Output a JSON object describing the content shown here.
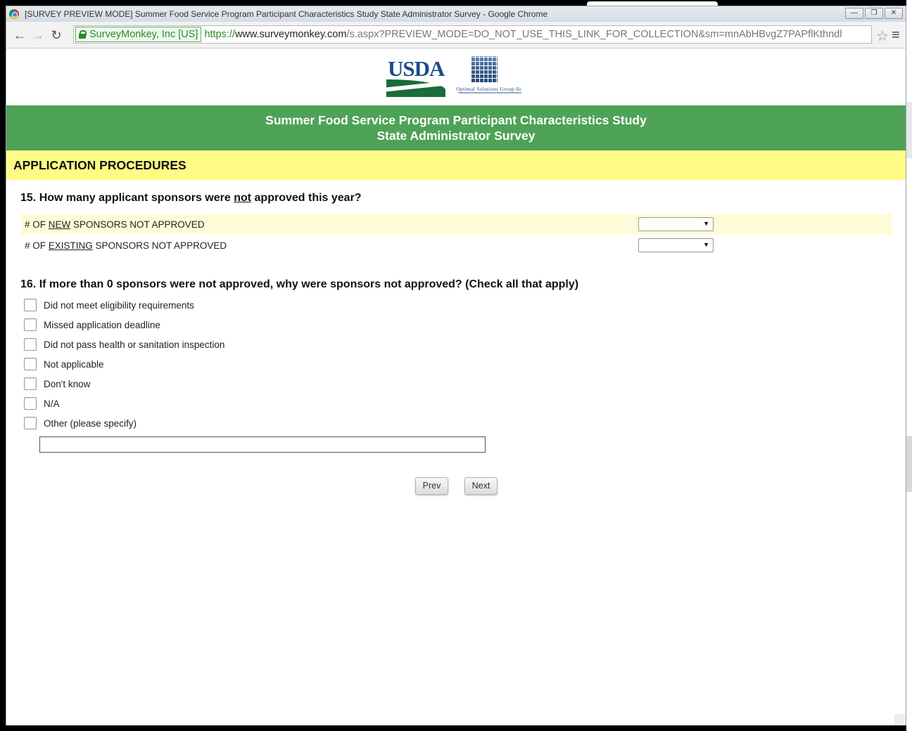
{
  "window": {
    "title": "[SURVEY PREVIEW MODE] Summer Food Service Program Participant Characteristics Study State Administrator Survey - Google Chrome",
    "controls": [
      "—",
      "❐",
      "✕"
    ]
  },
  "toolbar": {
    "back_icon": "←",
    "forward_icon": "→",
    "reload_icon": "↻",
    "ev_label": "SurveyMonkey, Inc [US]",
    "url_scheme": "https://",
    "url_host": "www.surveymonkey.com",
    "url_path": "/s.aspx?PREVIEW_MODE=DO_NOT_USE_THIS_LINK_FOR_COLLECTION&sm=mnAbHBvgZ7PAPflKthndl",
    "star_icon": "☆",
    "menu_icon": "≡"
  },
  "logos": {
    "usda": "USDA",
    "osg": "Optimal Solutions Group llc"
  },
  "banner": {
    "line1": "Summer Food Service Program Participant Characteristics Study",
    "line2": "State Administrator Survey"
  },
  "section_title": "APPLICATION PROCEDURES",
  "q15": {
    "prefix": "15. How many applicant sponsors were ",
    "emph": "not",
    "suffix": " approved this year?",
    "rows": [
      {
        "pre": "# OF ",
        "emph": "NEW",
        "post": " SPONSORS NOT APPROVED",
        "value": ""
      },
      {
        "pre": "# OF ",
        "emph": "EXISTING",
        "post": " SPONSORS NOT APPROVED",
        "value": ""
      }
    ],
    "dropdown_arrow": "▼"
  },
  "q16": {
    "text": "16. If more than 0 sponsors were not approved, why were sponsors not approved? (Check all that apply)",
    "options": [
      "Did not meet eligibility requirements",
      "Missed application deadline",
      "Did not pass health or sanitation inspection",
      "Not applicable",
      "Don't know",
      "N/A",
      "Other (please specify)"
    ],
    "other_value": ""
  },
  "nav": {
    "prev": "Prev",
    "next": "Next"
  }
}
